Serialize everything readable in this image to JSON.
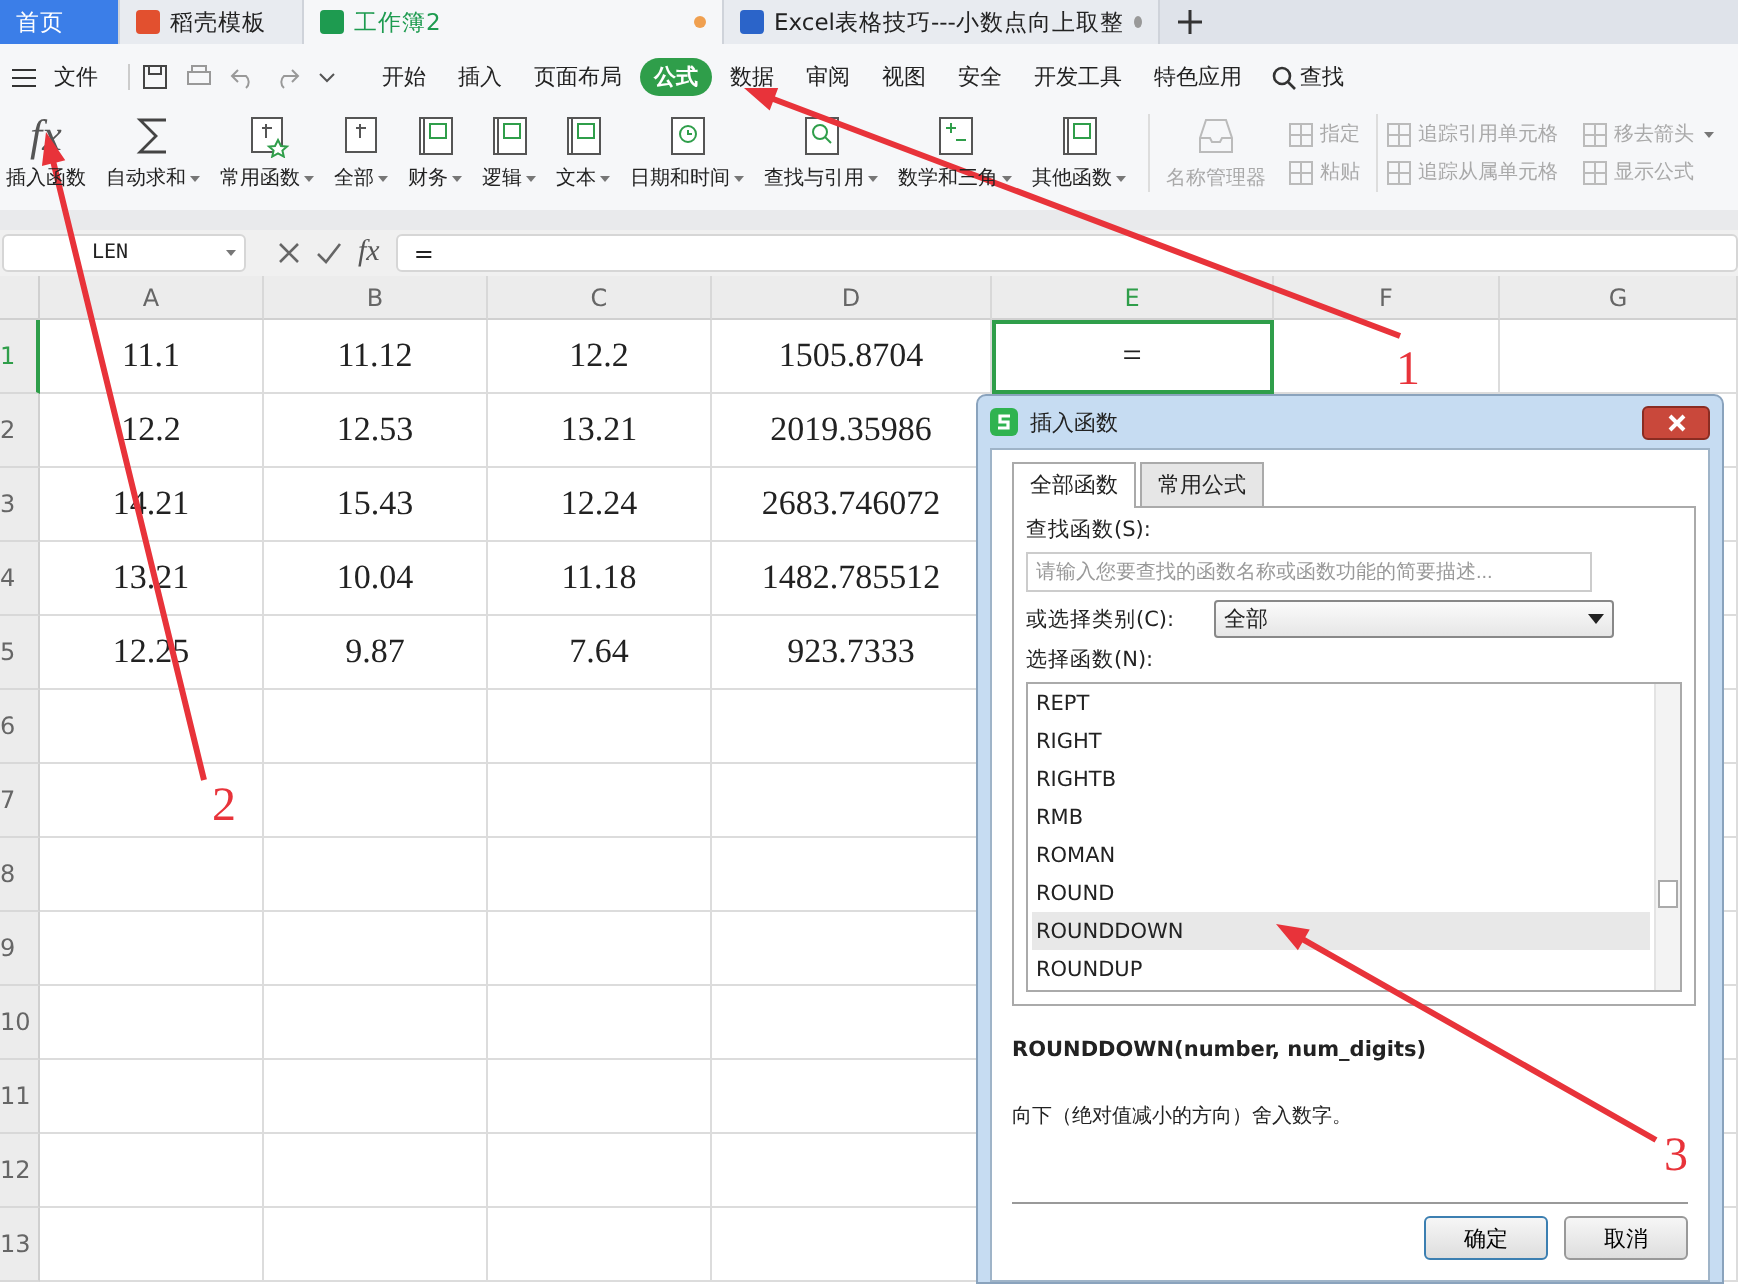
{
  "tabs": [
    {
      "label": "首页",
      "kind": "home",
      "selected": false
    },
    {
      "label": "稻壳模板",
      "kind": "docer",
      "selected": false
    },
    {
      "label": "工作簿2",
      "kind": "sheet",
      "selected": true
    },
    {
      "label": "Excel表格技巧---小数点向上取整",
      "kind": "doc",
      "selected": false
    }
  ],
  "menu": {
    "file": "文件",
    "items": [
      {
        "label": "开始",
        "selected": false
      },
      {
        "label": "插入",
        "selected": false
      },
      {
        "label": "页面布局",
        "selected": false
      },
      {
        "label": "公式",
        "selected": true
      },
      {
        "label": "数据",
        "selected": false
      },
      {
        "label": "审阅",
        "selected": false
      },
      {
        "label": "视图",
        "selected": false
      },
      {
        "label": "安全",
        "selected": false
      },
      {
        "label": "开发工具",
        "selected": false
      },
      {
        "label": "特色应用",
        "selected": false
      }
    ],
    "search": "查找"
  },
  "ribbon": {
    "items": [
      {
        "label": "插入函数",
        "kind": "fx",
        "symbol": "fx",
        "dropdown": false
      },
      {
        "label": "自动求和",
        "kind": "sum",
        "dropdown": true
      },
      {
        "label": "常用函数",
        "kind": "starred",
        "dropdown": true
      },
      {
        "label": "全部",
        "kind": "function",
        "dropdown": true
      },
      {
        "label": "财务",
        "kind": "book",
        "dropdown": true
      },
      {
        "label": "逻辑",
        "kind": "book",
        "dropdown": true
      },
      {
        "label": "文本",
        "kind": "book",
        "dropdown": true
      },
      {
        "label": "日期和时间",
        "kind": "clock",
        "dropdown": true
      },
      {
        "label": "查找与引用",
        "kind": "lookup",
        "dropdown": true
      },
      {
        "label": "数学和三角",
        "kind": "math",
        "dropdown": true
      },
      {
        "label": "其他函数",
        "kind": "book",
        "dropdown": true
      }
    ],
    "tools": [
      {
        "label": "名称管理器",
        "kind": "large",
        "disabled": true,
        "dropdown": false
      },
      {
        "label": "指定",
        "kind": "small",
        "disabled": true,
        "dropdown": false
      },
      {
        "label": "粘贴",
        "kind": "small",
        "disabled": true,
        "dropdown": false
      },
      {
        "label": "追踪引用单元格",
        "kind": "small",
        "disabled": true,
        "dropdown": false
      },
      {
        "label": "追踪从属单元格",
        "kind": "small",
        "disabled": true,
        "dropdown": false
      },
      {
        "label": "移去箭头",
        "kind": "small",
        "disabled": true,
        "dropdown": true
      },
      {
        "label": "显示公式",
        "kind": "small",
        "disabled": true,
        "dropdown": false
      }
    ]
  },
  "formula_bar": {
    "name_box": "LEN",
    "symbol": "fx",
    "value": "="
  },
  "sheet": {
    "columns": [
      {
        "label": "A",
        "selected": false
      },
      {
        "label": "B",
        "selected": false
      },
      {
        "label": "C",
        "selected": false
      },
      {
        "label": "D",
        "selected": false
      },
      {
        "label": "E",
        "selected": true
      },
      {
        "label": "F",
        "selected": false
      },
      {
        "label": "G",
        "selected": false
      }
    ],
    "rows": [
      {
        "header": "1",
        "selected": true,
        "cells": [
          "11.1",
          "11.12",
          "12.2",
          "1505.8704",
          "="
        ]
      },
      {
        "header": "2",
        "selected": false,
        "cells": [
          "12.2",
          "12.53",
          "13.21",
          "2019.35986"
        ]
      },
      {
        "header": "3",
        "selected": false,
        "cells": [
          "14.21",
          "15.43",
          "12.24",
          "2683.746072"
        ]
      },
      {
        "header": "4",
        "selected": false,
        "cells": [
          "13.21",
          "10.04",
          "11.18",
          "1482.785512"
        ]
      },
      {
        "header": "5",
        "selected": false,
        "cells": [
          "12.25",
          "9.87",
          "7.64",
          "923.7333"
        ]
      },
      {
        "header": "6",
        "selected": false
      },
      {
        "header": "7",
        "selected": false
      },
      {
        "header": "8",
        "selected": false
      },
      {
        "header": "9",
        "selected": false
      },
      {
        "header": "10",
        "selected": false
      },
      {
        "header": "11",
        "selected": false
      },
      {
        "header": "12",
        "selected": false
      },
      {
        "header": "13",
        "selected": false
      }
    ]
  },
  "dialog": {
    "title": "插入函数",
    "tabs": [
      {
        "label": "全部函数",
        "selected": true
      },
      {
        "label": "常用公式",
        "selected": false
      }
    ],
    "search_label": "查找函数(S):",
    "search_placeholder": "请输入您要查找的函数名称或函数功能的简要描述...",
    "category_label": "或选择类别(C):",
    "category": "全部",
    "list_label": "选择函数(N):",
    "functions": [
      {
        "label": "REPT",
        "selected": false
      },
      {
        "label": "RIGHT",
        "selected": false
      },
      {
        "label": "RIGHTB",
        "selected": false
      },
      {
        "label": "RMB",
        "selected": false
      },
      {
        "label": "ROMAN",
        "selected": false
      },
      {
        "label": "ROUND",
        "selected": false
      },
      {
        "label": "ROUNDDOWN",
        "selected": true
      },
      {
        "label": "ROUNDUP",
        "selected": false
      }
    ],
    "signature": "ROUNDDOWN(number, num_digits)",
    "description": "向下（绝对值减小的方向）舍入数字。",
    "buttons": [
      "确定",
      "取消"
    ]
  },
  "annotations": [
    {
      "label": "1"
    },
    {
      "label": "2"
    },
    {
      "label": "3"
    }
  ]
}
